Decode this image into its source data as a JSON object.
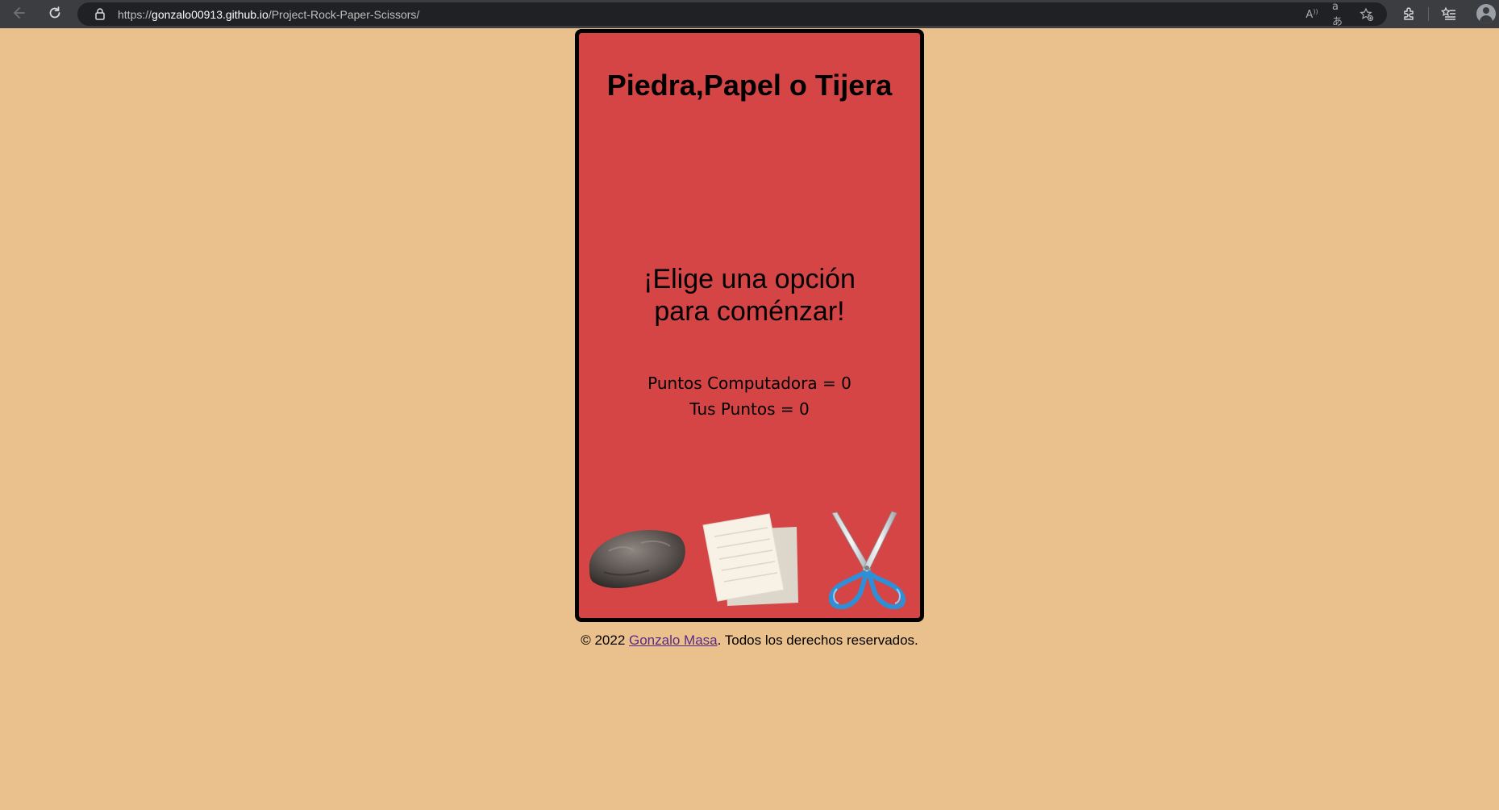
{
  "browser": {
    "url_prefix": "https://",
    "url_host": "gonzalo00913.github.io",
    "url_path": "/Project-Rock-Paper-Scissors/",
    "icons": [
      "back-arrow-icon",
      "refresh-icon",
      "lock-icon",
      "read-aloud-icon",
      "translate-icon",
      "favorite-add-icon",
      "extensions-icon",
      "favorites-icon",
      "profile-avatar-icon"
    ]
  },
  "game": {
    "title": "Piedra,Papel o Tijera",
    "prompt_line1": "¡Elige una opción",
    "prompt_line2": "para coménzar!",
    "score_computer": "Puntos Computadora = 0",
    "score_player": "Tus Puntos = 0",
    "choices": [
      "rock-image",
      "paper-image",
      "scissors-image"
    ]
  },
  "footer": {
    "prefix": "© 2022 ",
    "author_link": "Gonzalo Masa",
    "suffix": ". Todos los derechos reservados."
  },
  "colors": {
    "page_background": "#eac18d",
    "card_background": "#d54546",
    "card_border": "#000000",
    "link": "#5a2a86"
  }
}
